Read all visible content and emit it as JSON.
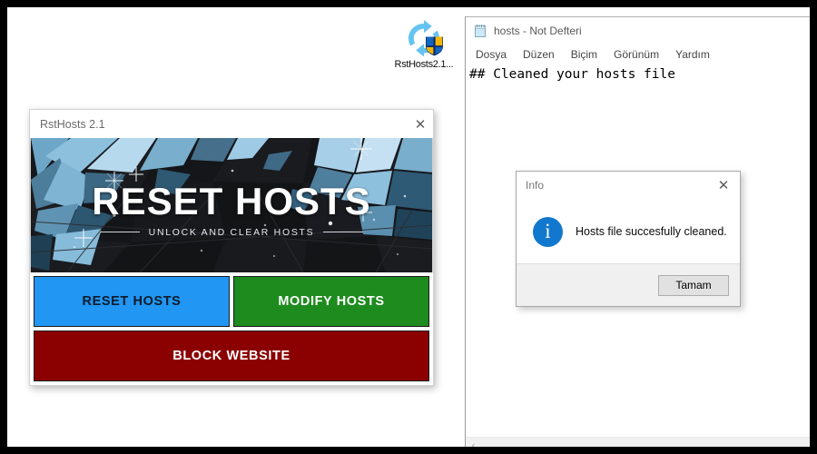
{
  "desktop": {
    "icon": {
      "name": "RstHosts2.1...",
      "icon_glyph": "reset-shield-icon"
    }
  },
  "notepad": {
    "title": "hosts - Not Defteri",
    "icon_glyph": "notepad-icon",
    "menu": [
      {
        "label": "Dosya"
      },
      {
        "label": "Düzen"
      },
      {
        "label": "Biçim"
      },
      {
        "label": "Görünüm"
      },
      {
        "label": "Yardım"
      }
    ],
    "content": "## Cleaned your hosts file",
    "hscroll_left_arrow": "‹"
  },
  "info_dialog": {
    "title": "Info",
    "close_glyph": "✕",
    "icon_letter": "i",
    "message": "Hosts file succesfully cleaned.",
    "ok_label": "Tamam"
  },
  "rsthosts": {
    "title": "RstHosts 2.1",
    "close_glyph": "✕",
    "banner": {
      "headline": "RESET HOSTS",
      "subline": "UNLOCK AND CLEAR HOSTS"
    },
    "buttons": [
      {
        "label": "RESET HOSTS",
        "bg": "#2196f3",
        "fg": "#0d1b2a"
      },
      {
        "label": "MODIFY HOSTS",
        "bg": "#1e8b1e",
        "fg": "#ffffff"
      },
      {
        "label": "BLOCK WEBSITE",
        "bg": "#8b0000",
        "fg": "#ffffff"
      }
    ]
  },
  "colors": {
    "frame": "#000000",
    "desktop_bg": "#ffffff",
    "blue": "#2196f3",
    "green": "#1e8b1e",
    "dark_red": "#8b0000",
    "banner_dark": "#111113",
    "info_blue": "#1278ce"
  }
}
